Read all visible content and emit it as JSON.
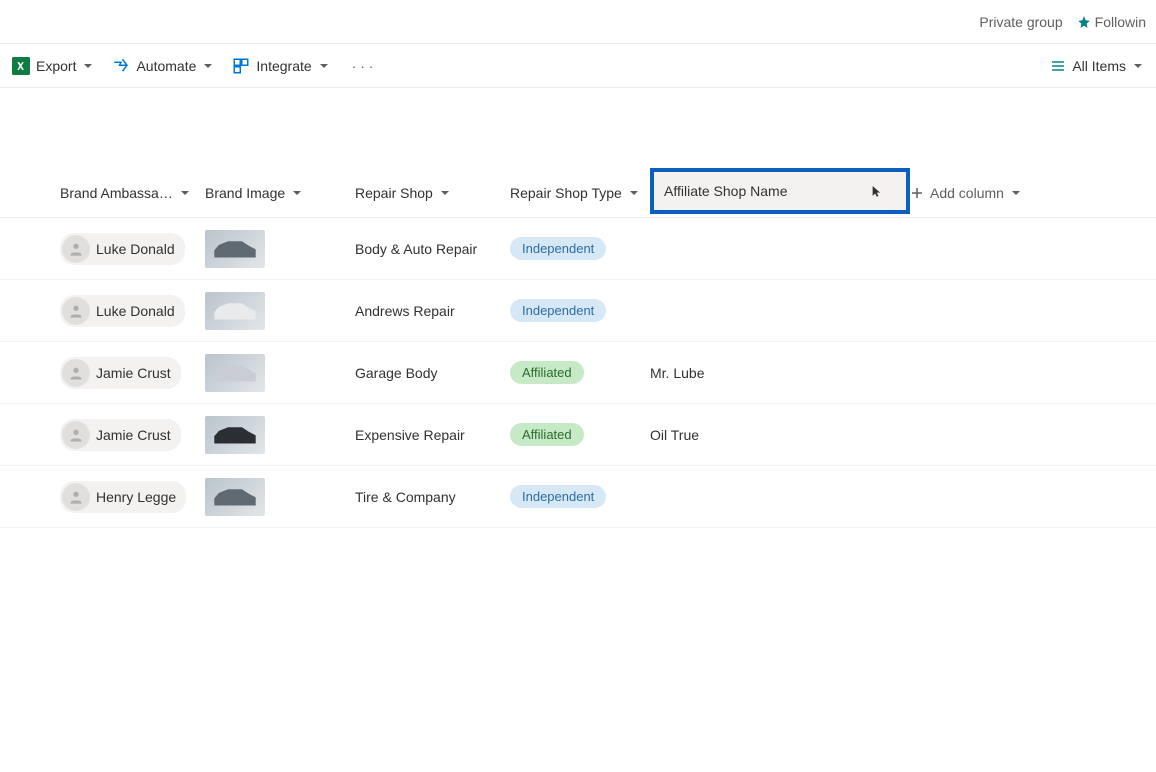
{
  "top": {
    "private_group": "Private group",
    "following": "Followin"
  },
  "commands": {
    "export": "Export",
    "automate": "Automate",
    "integrate": "Integrate",
    "all_items": "All Items"
  },
  "columns": {
    "ambassador": "Brand Ambassa…",
    "image": "Brand Image",
    "repair_shop": "Repair Shop",
    "repair_type": "Repair Shop Type",
    "affiliate_editing_value": "Affiliate Shop Name",
    "add_column": "Add column"
  },
  "rows": [
    {
      "ambassador": "Luke Donald",
      "shop": "Body & Auto Repair",
      "type": "Independent",
      "type_kind": "indep",
      "affiliate": ""
    },
    {
      "ambassador": "Luke Donald",
      "shop": "Andrews Repair",
      "type": "Independent",
      "type_kind": "indep",
      "affiliate": ""
    },
    {
      "ambassador": "Jamie Crust",
      "shop": "Garage Body",
      "type": "Affiliated",
      "type_kind": "aff",
      "affiliate": "Mr. Lube"
    },
    {
      "ambassador": "Jamie Crust",
      "shop": "Expensive Repair",
      "type": "Affiliated",
      "type_kind": "aff",
      "affiliate": "Oil True"
    },
    {
      "ambassador": "Henry Legge",
      "shop": "Tire & Company",
      "type": "Independent",
      "type_kind": "indep",
      "affiliate": ""
    }
  ]
}
